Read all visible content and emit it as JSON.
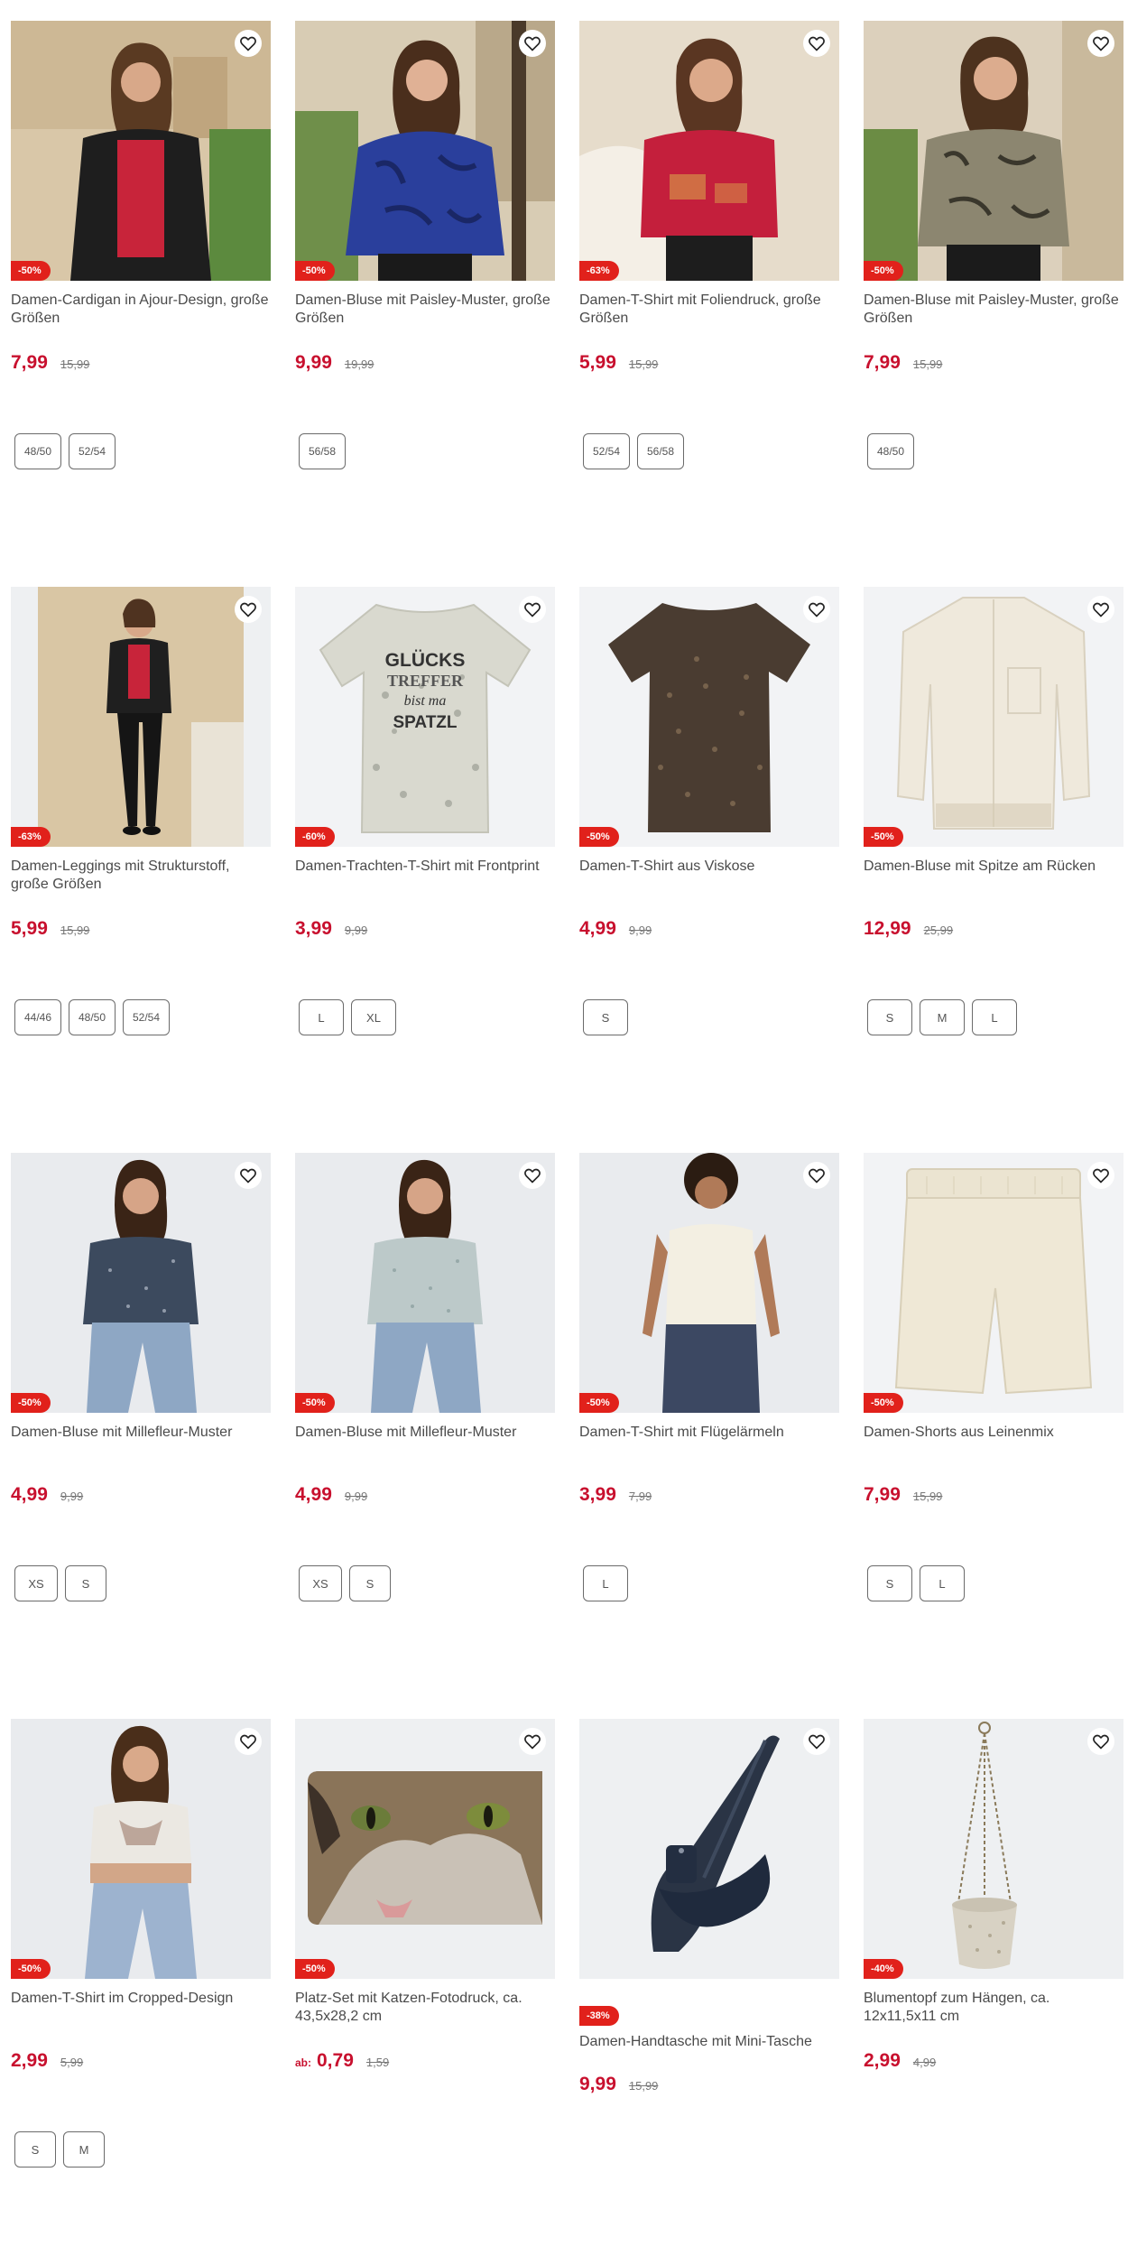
{
  "products": [
    {
      "title": "Damen-Cardigan in Ajour-Design, große Größen",
      "badge": "-50%",
      "price": "7,99",
      "old_price": "15,99",
      "sizes": [
        "48/50",
        "52/54"
      ]
    },
    {
      "title": "Damen-Bluse mit Paisley-Muster, große Größen",
      "badge": "-50%",
      "price": "9,99",
      "old_price": "19,99",
      "sizes": [
        "56/58"
      ]
    },
    {
      "title": "Damen-T-Shirt mit Foliendruck, große Größen",
      "badge": "-63%",
      "price": "5,99",
      "old_price": "15,99",
      "sizes": [
        "52/54",
        "56/58"
      ]
    },
    {
      "title": "Damen-Bluse mit Paisley-Muster, große Größen",
      "badge": "-50%",
      "price": "7,99",
      "old_price": "15,99",
      "sizes": [
        "48/50"
      ]
    },
    {
      "title": "Damen-Leggings mit Strukturstoff, große Größen",
      "badge": "-63%",
      "price": "5,99",
      "old_price": "15,99",
      "sizes": [
        "44/46",
        "48/50",
        "52/54"
      ]
    },
    {
      "title": "Damen-Trachten-T-Shirt mit Frontprint",
      "badge": "-60%",
      "price": "3,99",
      "old_price": "9,99",
      "sizes": [
        "L",
        "XL"
      ],
      "print_text": [
        "GLÜCKS",
        "TREFFER",
        "bist ma",
        "SPATZL"
      ]
    },
    {
      "title": "Damen-T-Shirt aus Viskose",
      "badge": "-50%",
      "price": "4,99",
      "old_price": "9,99",
      "sizes": [
        "S"
      ]
    },
    {
      "title": "Damen-Bluse mit Spitze am Rücken",
      "badge": "-50%",
      "price": "12,99",
      "old_price": "25,99",
      "sizes": [
        "S",
        "M",
        "L"
      ]
    },
    {
      "title": "Damen-Bluse mit Millefleur-Muster",
      "badge": "-50%",
      "price": "4,99",
      "old_price": "9,99",
      "sizes": [
        "XS",
        "S"
      ]
    },
    {
      "title": "Damen-Bluse mit Millefleur-Muster",
      "badge": "-50%",
      "price": "4,99",
      "old_price": "9,99",
      "sizes": [
        "XS",
        "S"
      ]
    },
    {
      "title": "Damen-T-Shirt mit Flügelärmeln",
      "badge": "-50%",
      "price": "3,99",
      "old_price": "7,99",
      "sizes": [
        "L"
      ]
    },
    {
      "title": "Damen-Shorts aus Leinenmix",
      "badge": "-50%",
      "price": "7,99",
      "old_price": "15,99",
      "sizes": [
        "S",
        "L"
      ]
    },
    {
      "title": "Damen-T-Shirt im Cropped-Design",
      "badge": "-50%",
      "price": "2,99",
      "old_price": "5,99",
      "sizes": [
        "S",
        "M"
      ]
    },
    {
      "title": "Platz-Set mit Katzen-Fotodruck, ca. 43,5x28,2 cm",
      "badge": "-50%",
      "price": "0,79",
      "price_prefix": "ab:",
      "old_price": "1,59",
      "sizes": []
    },
    {
      "title": "Damen-Handtasche mit Mini-Tasche",
      "badge": "-38%",
      "price": "9,99",
      "old_price": "15,99",
      "sizes": []
    },
    {
      "title": "Blumentopf zum Hängen, ca. 12x11,5x11 cm",
      "badge": "-40%",
      "price": "2,99",
      "old_price": "4,99",
      "sizes": []
    }
  ],
  "colors": {
    "price": "#c8102e",
    "badge": "#e1211b",
    "text": "#4a4a4a"
  }
}
